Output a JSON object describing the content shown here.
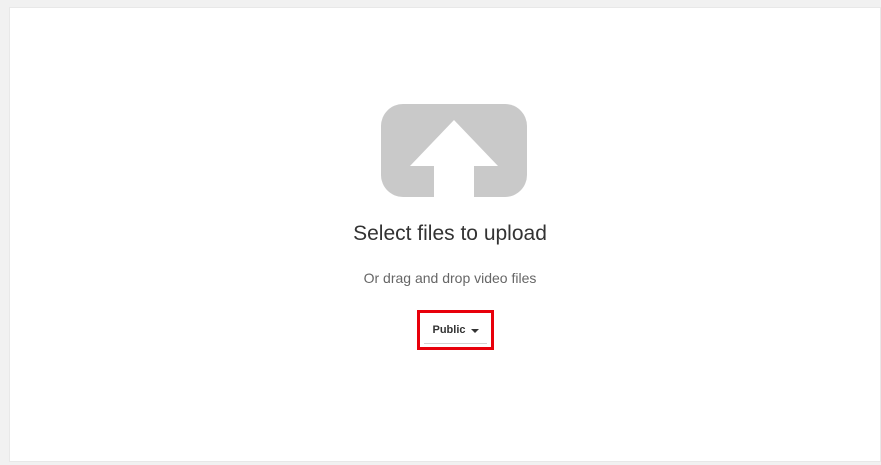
{
  "upload": {
    "title": "Select files to upload",
    "subtitle": "Or drag and drop video files",
    "icon": "upload-arrow-icon"
  },
  "privacy": {
    "selected": "Public",
    "icon": "caret-down-icon"
  },
  "colors": {
    "icon_gray": "#c9c9c9",
    "highlight_red": "#e8000b"
  }
}
